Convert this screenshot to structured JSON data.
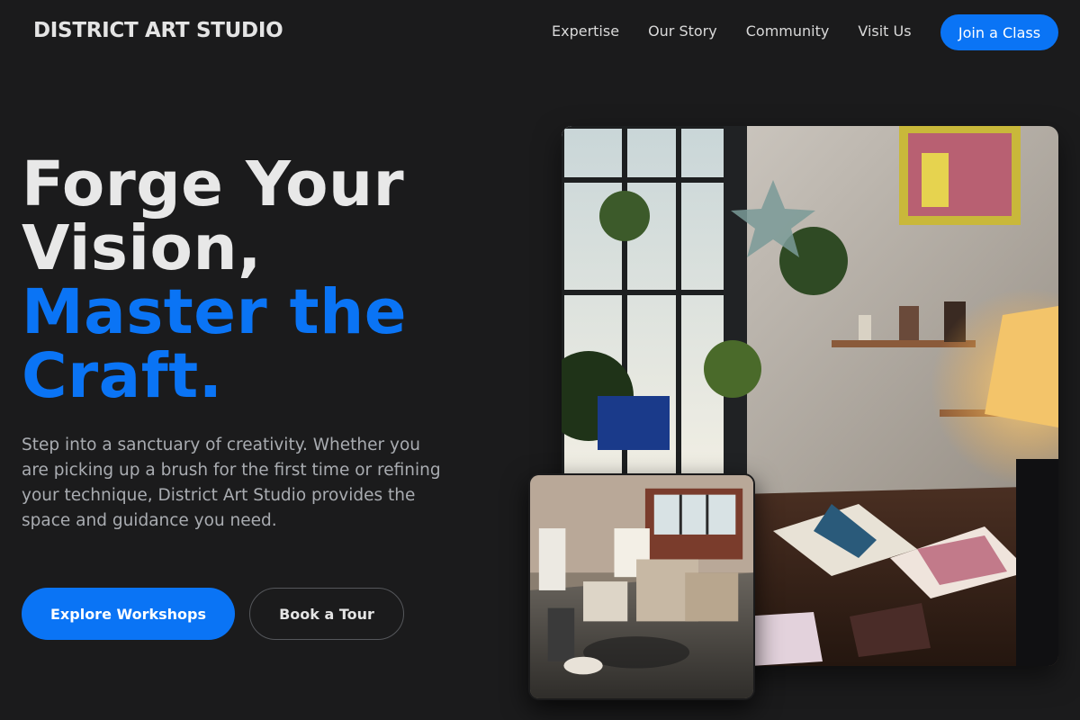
{
  "header": {
    "logo": "DISTRICT ART STUDIO",
    "nav": [
      "Expertise",
      "Our Story",
      "Community",
      "Visit Us"
    ],
    "cta": "Join a Class"
  },
  "hero": {
    "title_line1": "Forge Your Vision,",
    "title_line2": "Master the Craft.",
    "description": "Step into a sanctuary of creativity. Whether you are picking up a brush for the first time or refining your technique, District Art Studio provides the space and guidance you need.",
    "primary_button": "Explore Workshops",
    "secondary_button": "Book a Tour"
  },
  "images": {
    "main": "art-studio-interior-photo",
    "secondary": "studio-workspace-photo"
  },
  "colors": {
    "background": "#1b1b1c",
    "accent": "#0a74f5",
    "text_primary": "#e8e8e8",
    "text_muted": "#a9acb1"
  }
}
